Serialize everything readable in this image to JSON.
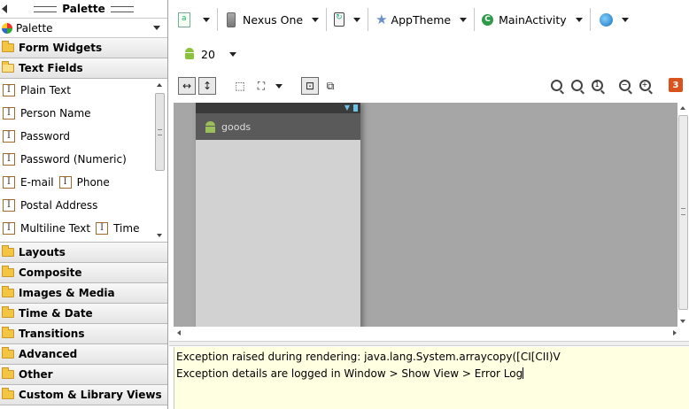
{
  "palette": {
    "title": "Palette",
    "selector_label": "Palette",
    "categories_top": [
      {
        "label": "Form Widgets",
        "open": false
      },
      {
        "label": "Text Fields",
        "open": true
      }
    ],
    "text_fields": [
      [
        "Plain Text"
      ],
      [
        "Person Name"
      ],
      [
        "Password"
      ],
      [
        "Password (Numeric)"
      ],
      [
        "E-mail",
        "Phone"
      ],
      [
        "Postal Address"
      ],
      [
        "Multiline Text",
        "Time"
      ]
    ],
    "categories_bottom": [
      "Layouts",
      "Composite",
      "Images & Media",
      "Time & Date",
      "Transitions",
      "Advanced",
      "Other",
      "Custom & Library Views"
    ]
  },
  "toolbar": {
    "device": "Nexus One",
    "theme": "AppTheme",
    "activity": "MainActivity",
    "api_level": "20",
    "error_count": "3"
  },
  "preview": {
    "app_title": "goods"
  },
  "error_log": {
    "line1": "Exception raised during rendering: java.lang.System.arraycopy([CI[CII)V",
    "line2": "Exception details are logged in Window > Show View > Error Log"
  },
  "colors": {
    "canvas_bg": "#a6a6a6",
    "error_bg": "#ffffe1",
    "error_badge": "#d9531e",
    "android_green": "#8ac23a"
  }
}
